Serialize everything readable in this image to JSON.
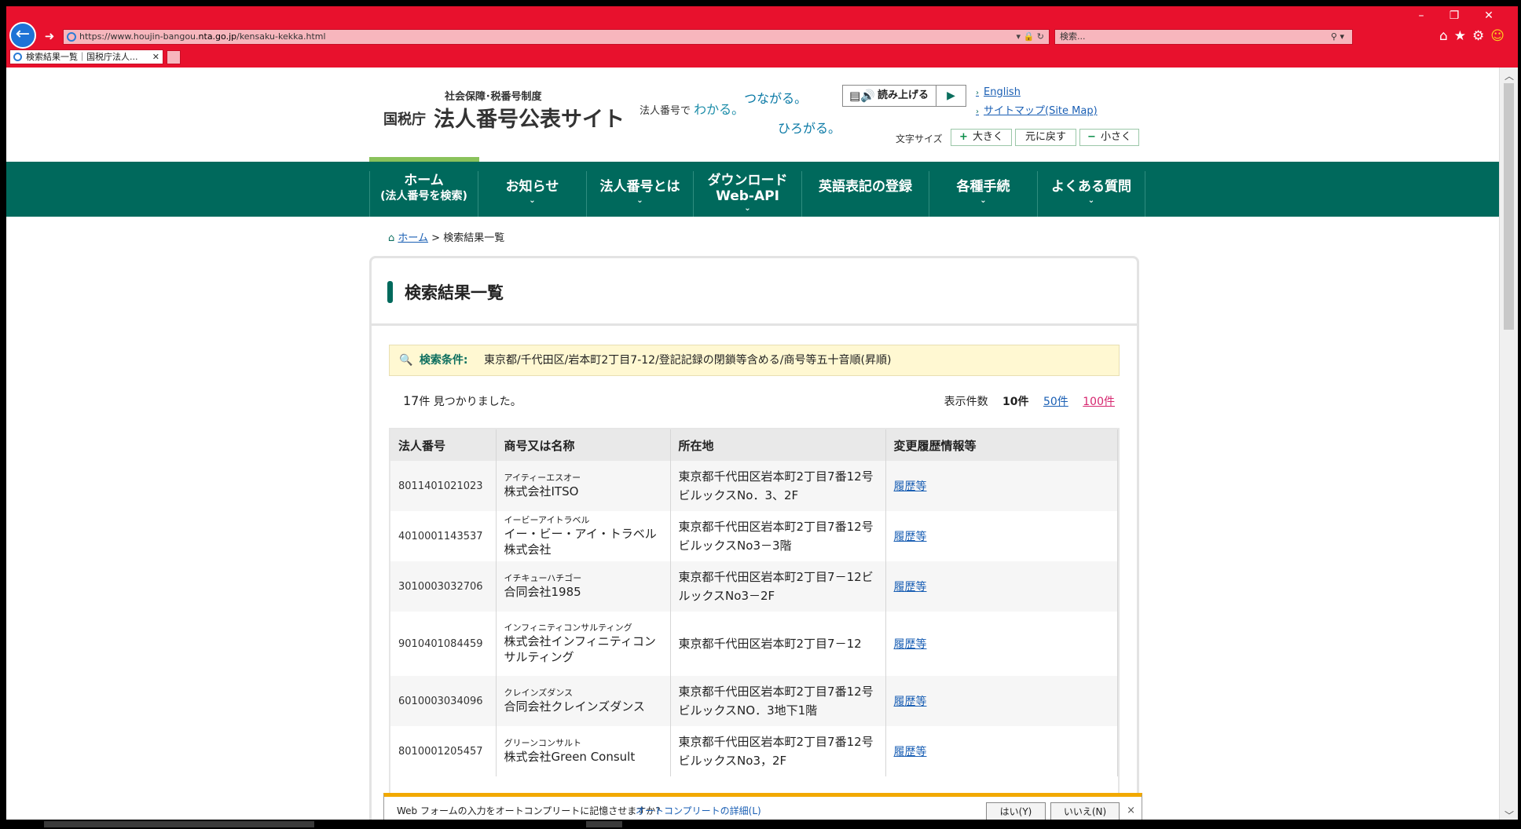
{
  "browser": {
    "url": "https://www.houjin-bangou.nta.go.jp/kensaku-kekka.html",
    "url_host": "www.houjin-bangou.",
    "url_domain": "nta.go.jp",
    "url_prefix": "https://",
    "url_path": "/kensaku-kekka.html",
    "search_placeholder": "検索...",
    "tab_title": "検索結果一覧｜国税庁法人...",
    "window_controls": [
      "–",
      "❐",
      "✕"
    ]
  },
  "header": {
    "sub_title": "社会保障･税番号制度",
    "org": "国税庁",
    "site_name": "法人番号公表サイト",
    "slogan_prefix": "法人番号で",
    "slogan_1": "わかる。",
    "slogan_2": "つながる。",
    "slogan_3": "ひろがる。",
    "read_aloud": "読み上げる",
    "english": "English",
    "sitemap": "サイトマップ(Site Map)",
    "font_size_label": "文字サイズ",
    "font_larger": "大きく",
    "font_reset": "元に戻す",
    "font_smaller": "小さく"
  },
  "nav": {
    "items": [
      {
        "line1": "ホーム",
        "line2": "(法人番号を検索)",
        "chevron": ""
      },
      {
        "line1": "お知らせ",
        "line2": "",
        "chevron": "⌄"
      },
      {
        "line1": "法人番号とは",
        "line2": "",
        "chevron": "⌄"
      },
      {
        "line1": "ダウンロード",
        "line2": "Web-API",
        "chevron": "⌄"
      },
      {
        "line1": "英語表記の登録",
        "line2": "",
        "chevron": ""
      },
      {
        "line1": "各種手続",
        "line2": "",
        "chevron": "⌄"
      },
      {
        "line1": "よくある質問",
        "line2": "",
        "chevron": "⌄"
      }
    ]
  },
  "breadcrumb": {
    "home": "ホーム",
    "sep": ">",
    "current": "検索結果一覧"
  },
  "main": {
    "title": "検索結果一覧",
    "condition_label": "検索条件:",
    "condition_text": "東京都/千代田区/岩本町2丁目7-12/登記記録の閉鎖等含める/商号等五十音順(昇順)",
    "count_num": "17",
    "count_text": "件 見つかりました。",
    "per_page_label": "表示件数",
    "per_page_current": "10件",
    "per_page_50": "50件",
    "per_page_100": "100件",
    "table": {
      "headers": [
        "法人番号",
        "商号又は名称",
        "所在地",
        "変更履歴情報等"
      ],
      "rows": [
        {
          "number": "8011401021023",
          "kana": "アイティーエスオー",
          "name": "株式会社ITSO",
          "address": "東京都千代田区岩本町2丁目7番12号ビルックスNo．3、2F",
          "link": "履歴等"
        },
        {
          "number": "4010001143537",
          "kana": "イービーアイトラベル",
          "name": "イー・ビー・アイ・トラベル株式会社",
          "address": "東京都千代田区岩本町2丁目7番12号ビルックスNo3－3階",
          "link": "履歴等"
        },
        {
          "number": "3010003032706",
          "kana": "イチキューハチゴー",
          "name": "合同会社1985",
          "address": "東京都千代田区岩本町2丁目7－12ビルックスNo3－2F",
          "link": "履歴等"
        },
        {
          "number": "9010401084459",
          "kana": "インフィニティコンサルティング",
          "name": "株式会社インフィニティコンサルティング",
          "address": "東京都千代田区岩本町2丁目7－12",
          "link": "履歴等"
        },
        {
          "number": "6010003034096",
          "kana": "クレインズダンス",
          "name": "合同会社クレインズダンス",
          "address": "東京都千代田区岩本町2丁目7番12号ビルックスNO．3地下1階",
          "link": "履歴等"
        },
        {
          "number": "8010001205457",
          "kana": "グリーンコンサルト",
          "name": "株式会社Green Consult",
          "address": "東京都千代田区岩本町2丁目7番12号ビルックスNo3，2F",
          "link": "履歴等"
        }
      ]
    }
  },
  "autocomplete": {
    "message": "Web フォームの入力をオートコンプリートに記憶させますか?",
    "link": "オートコンプリートの詳細(L)",
    "yes": "はい(Y)",
    "no": "いいえ(N)",
    "close": "×"
  },
  "colors": {
    "chrome": "#e8112d",
    "nav": "#00695c",
    "accent": "#8ac25b",
    "warning_bar": "#f2a900"
  },
  "icons": [
    "back-arrow-icon",
    "forward-arrow-icon",
    "ie-icon",
    "lock-icon",
    "refresh-icon",
    "search-icon",
    "home-icon",
    "favorites-star-icon",
    "gear-icon",
    "smiley-icon",
    "speaker-icon",
    "play-icon",
    "magnifier-icon"
  ]
}
